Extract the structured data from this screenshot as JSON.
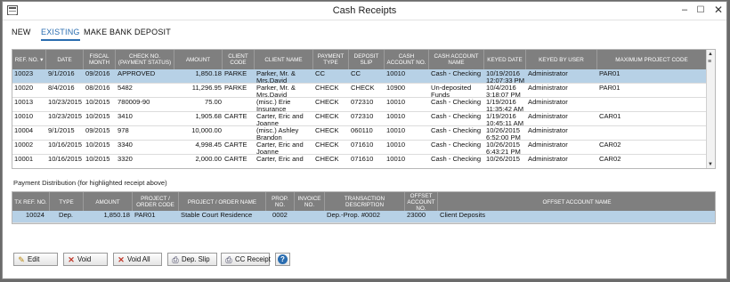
{
  "window": {
    "title": "Cash Receipts",
    "min": "–",
    "max": "☐",
    "close": "✕"
  },
  "tabs": [
    {
      "label": "NEW"
    },
    {
      "label": "EXISTING"
    },
    {
      "label": "MAKE BANK DEPOSIT"
    }
  ],
  "receipts": {
    "headers": [
      "REF. NO. ▾",
      "DATE",
      "FISCAL MONTH",
      "CHECK NO. (PAYMENT STATUS)",
      "AMOUNT",
      "CLIENT CODE",
      "CLIENT NAME",
      "PAYMENT TYPE",
      "DEPOSIT SLIP",
      "CASH ACCOUNT NO.",
      "CASH ACCOUNT NAME",
      "KEYED DATE",
      "KEYED BY USER",
      "MAXIMUM PROJECT CODE"
    ],
    "rows": [
      [
        "10023",
        "9/1/2016",
        "09/2016",
        "APPROVED",
        "1,850.18",
        "PARKE",
        "Parker, Mr. & Mrs.David",
        "CC",
        "CC",
        "10010",
        "Cash - Checking",
        "10/19/2016 12:07:33 PM",
        "Administrator",
        "PAR01"
      ],
      [
        "10020",
        "8/4/2016",
        "08/2016",
        "5482",
        "11,296.95",
        "PARKE",
        "Parker, Mr. & Mrs.David",
        "CHECK",
        "CHECK",
        "10900",
        "Un-deposited Funds",
        "10/4/2016 3:18:07 PM",
        "Administrator",
        "PAR01"
      ],
      [
        "10013",
        "10/23/2015",
        "10/2015",
        "780009-90",
        "75.00",
        "",
        "(misc.) Erie Insurance",
        "CHECK",
        "072310",
        "10010",
        "Cash - Checking",
        "1/19/2016 11:35:42 AM",
        "Administrator",
        ""
      ],
      [
        "10010",
        "10/23/2015",
        "10/2015",
        "3410",
        "1,905.68",
        "CARTE",
        "Carter, Eric and Joanne",
        "CHECK",
        "072310",
        "10010",
        "Cash - Checking",
        "1/19/2016 10:45:11 AM",
        "Administrator",
        "CAR01"
      ],
      [
        "10004",
        "9/1/2015",
        "09/2015",
        "978",
        "10,000.00",
        "",
        "(misc.) Ashley Brandon",
        "CHECK",
        "060110",
        "10010",
        "Cash - Checking",
        "10/26/2015 6:52:00 PM",
        "Administrator",
        ""
      ],
      [
        "10002",
        "10/16/2015",
        "10/2015",
        "3340",
        "4,998.45",
        "CARTE",
        "Carter, Eric and Joanne",
        "CHECK",
        "071610",
        "10010",
        "Cash - Checking",
        "10/26/2015 6:43:21 PM",
        "Administrator",
        "CAR02"
      ],
      [
        "10001",
        "10/16/2015",
        "10/2015",
        "3320",
        "2,000.00",
        "CARTE",
        "Carter, Eric and",
        "CHECK",
        "071610",
        "10010",
        "Cash - Checking",
        "10/26/2015",
        "Administrator",
        "CAR02"
      ]
    ],
    "scroll_icons": {
      "up": "▲",
      "grip": "≡",
      "down": "▼"
    }
  },
  "distribution": {
    "label": "Payment Distribution (for highlighted receipt above)",
    "headers": [
      "TX REF. NO.",
      "TYPE",
      "AMOUNT",
      "PROJECT / ORDER CODE",
      "PROJECT / ORDER NAME",
      "PROP. NO.",
      "INVOICE NO.",
      "TRANSACTION DESCRIPTION",
      "OFFSET ACCOUNT NO.",
      "OFFSET ACCOUNT NAME"
    ],
    "rows": [
      [
        "10024",
        "Dep.",
        "1,850.18",
        "PAR01",
        "Stable Court Residence",
        "0002",
        "",
        "Dep.-Prop. #0002",
        "23000",
        "Client Deposits"
      ]
    ]
  },
  "buttons": {
    "edit": {
      "label": "Edit",
      "icon": "pencil-icon"
    },
    "void": {
      "label": "Void",
      "icon": "x-icon"
    },
    "void_all": {
      "label": "Void All",
      "icon": "x-icon"
    },
    "dep_slip": {
      "label": "Dep. Slip",
      "icon": "printer-icon"
    },
    "cc_receipt": {
      "label": "CC Receipt",
      "icon": "printer-icon"
    },
    "help": {
      "label": "?",
      "icon": "help-icon"
    }
  },
  "colors": {
    "accent": "#2a6db0",
    "header_bg": "#7f7f7f",
    "selected_row": "#b7d1e6",
    "void_red": "#c0392b"
  }
}
